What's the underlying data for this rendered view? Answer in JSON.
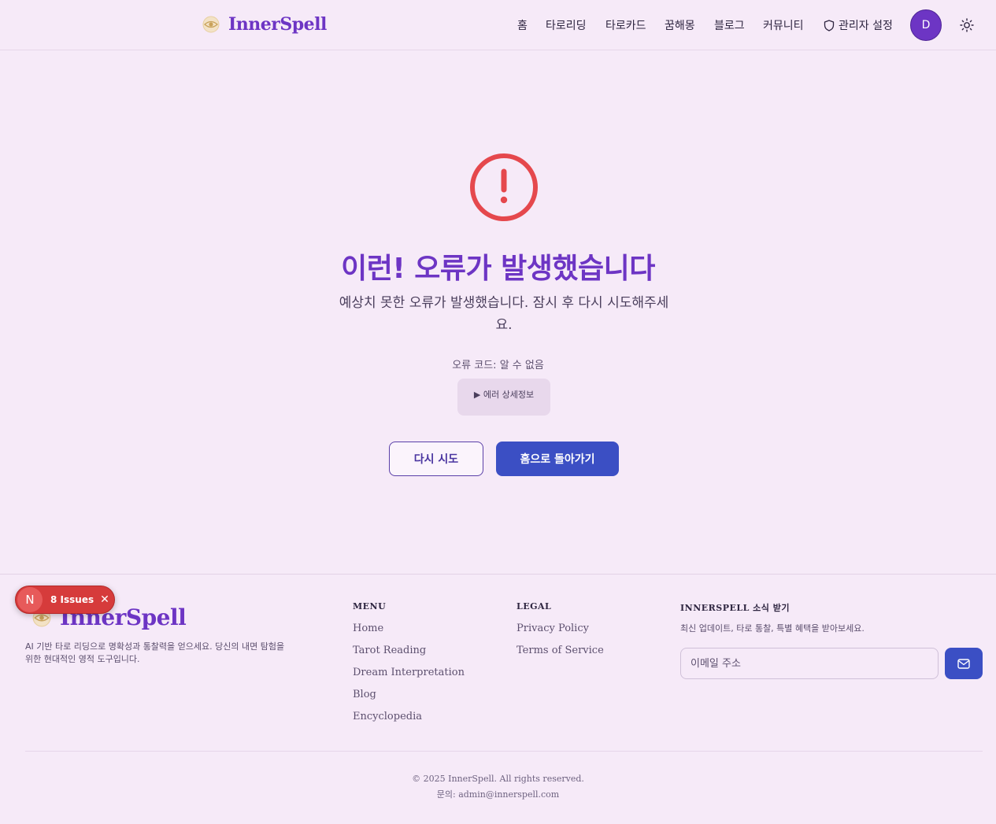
{
  "brand": {
    "name": "InnerSpell"
  },
  "nav": {
    "items": [
      "홈",
      "타로리딩",
      "타로카드",
      "꿈해몽",
      "블로그",
      "커뮤니티"
    ],
    "admin_label": "관리자 설정",
    "avatar_initial": "D"
  },
  "error": {
    "title": "이런! 오류가 발생했습니다",
    "description": "예상치 못한 오류가 발생했습니다. 잠시 후 다시 시도해주세요.",
    "code_text": "오류 코드: 알 수 없음",
    "details_label": "▶ 에러 상세정보",
    "retry_label": "다시 시도",
    "home_label": "홈으로 돌아가기"
  },
  "footer": {
    "tagline": "AI 기반 타로 리딩으로 명확성과 통찰력을 얻으세요. 당신의 내면 탐험을 위한 현대적인 영적 도구입니다.",
    "menu": {
      "heading": "MENU",
      "links": [
        "Home",
        "Tarot Reading",
        "Dream Interpretation",
        "Blog",
        "Encyclopedia"
      ]
    },
    "legal": {
      "heading": "LEGAL",
      "links": [
        "Privacy Policy",
        "Terms of Service"
      ]
    },
    "newsletter": {
      "heading": "INNERSPELL 소식 받기",
      "description": "최신 업데이트, 타로 통찰, 특별 혜택을 받아보세요.",
      "email_placeholder": "이메일 주소"
    },
    "copyright": "© 2025 InnerSpell. All rights reserved.",
    "contact": "문의: admin@innerspell.com"
  },
  "dev_overlay": {
    "badge": "N",
    "issues_label": "8 Issues"
  },
  "colors": {
    "brand": "#6d35c4",
    "primary_button": "#3b4fc4",
    "error": "#e5484d",
    "background": "#f6eaf8"
  },
  "icons": [
    "logo-eye-icon",
    "shield-icon",
    "sun-icon",
    "alert-circle-icon",
    "mail-icon",
    "close-icon"
  ]
}
